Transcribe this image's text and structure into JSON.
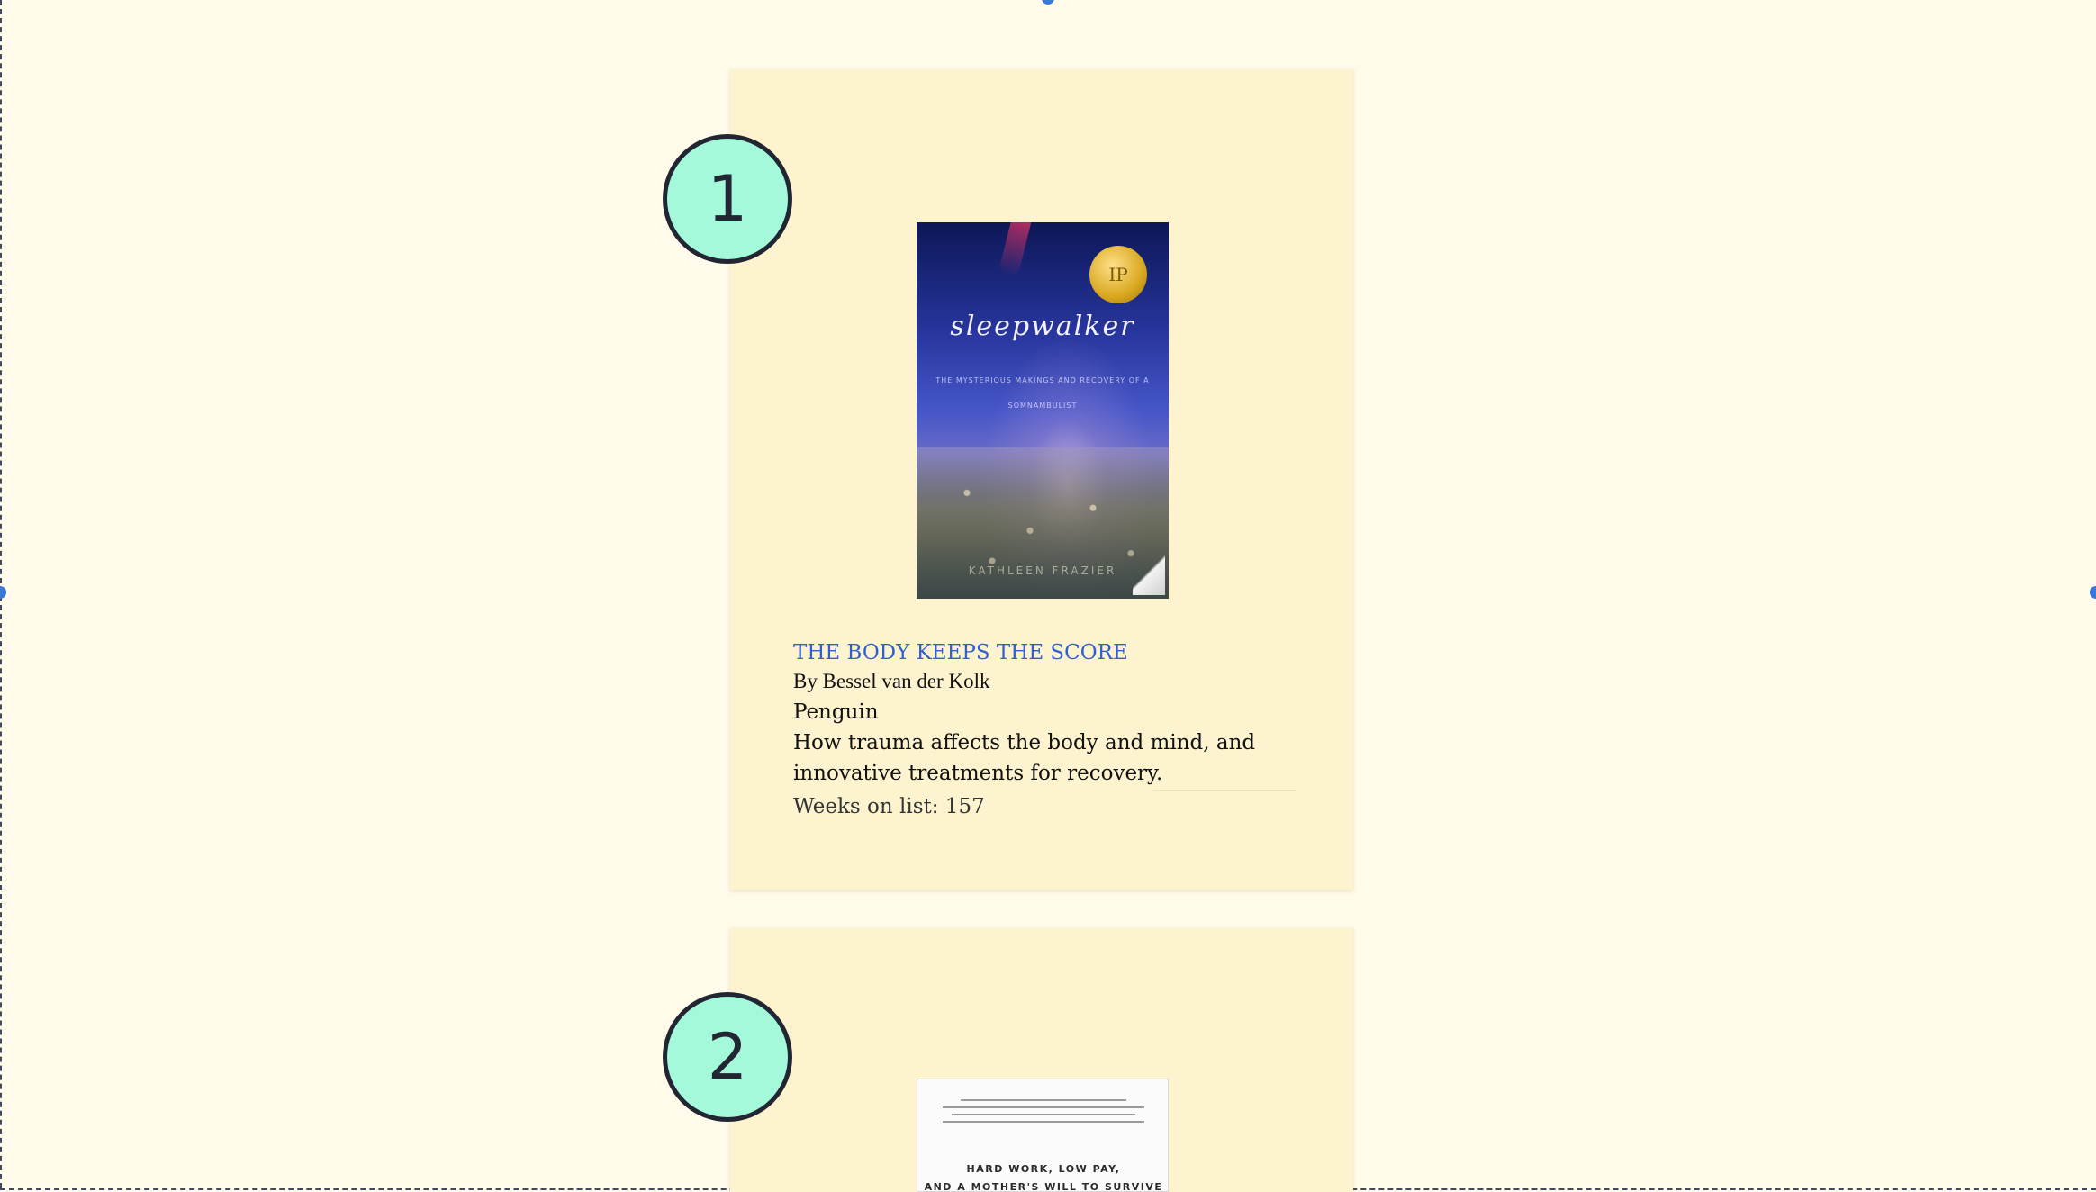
{
  "colors": {
    "page_background": "#fffaea",
    "card_background": "#fdf3cf",
    "badge_fill": "#a3f9d9",
    "badge_border": "#222632",
    "link": "#2f5fd0",
    "selection_handle": "#3a79d8"
  },
  "books": [
    {
      "rank": "1",
      "cover": {
        "title": "sleepwalker",
        "subtitle": "THE MYSTERIOUS MAKINGS AND RECOVERY OF A SOMNAMBULIST",
        "author": "KATHLEEN FRAZIER",
        "seal": "IP"
      },
      "title": "THE BODY KEEPS THE SCORE",
      "author": "By Bessel van der Kolk",
      "publisher": "Penguin",
      "description": "How trauma affects the body and mind, and innovative treatments for recovery.",
      "weeks_on_list": "Weeks on list: 157"
    },
    {
      "rank": "2",
      "cover": {
        "tagline_line1": "HARD WORK, LOW PAY,",
        "tagline_line2": "AND A MOTHER'S WILL TO SURVIVE"
      }
    }
  ]
}
